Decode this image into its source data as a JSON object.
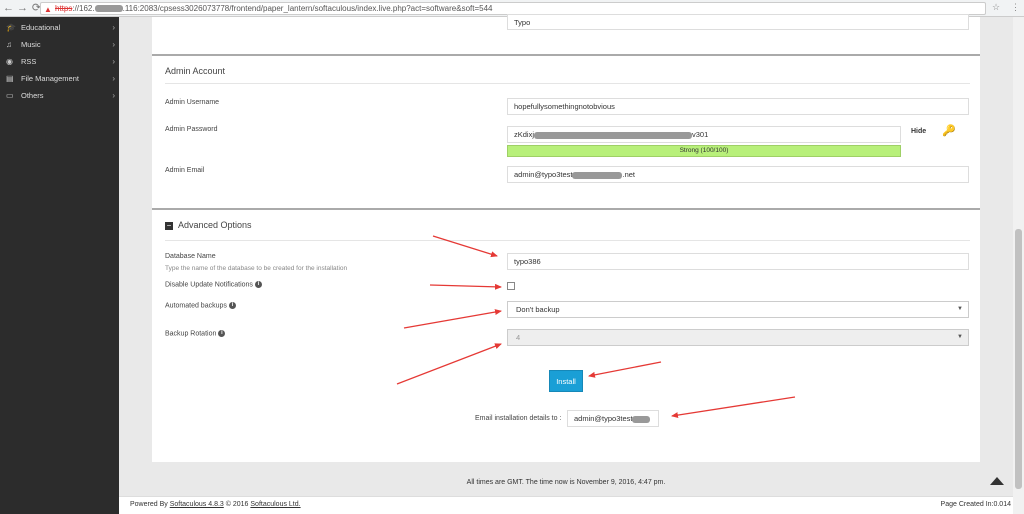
{
  "browser": {
    "url_scheme": "https",
    "url_host_start": "://162.",
    "url_host_end": ".116",
    "url_rest": ":2083/cpsess3026073778/frontend/paper_lantern/softaculous/index.live.php?act=software&soft=544"
  },
  "sidebar": {
    "items": [
      {
        "label": "Educational",
        "icon": "graduation-cap-icon"
      },
      {
        "label": "Music",
        "icon": "music-note-icon"
      },
      {
        "label": "RSS",
        "icon": "rss-icon"
      },
      {
        "label": "File Management",
        "icon": "file-management-icon"
      },
      {
        "label": "Others",
        "icon": "folder-icon"
      }
    ]
  },
  "top_field": {
    "value": "Typo"
  },
  "admin": {
    "title": "Admin Account",
    "username_label": "Admin Username",
    "username_value": "hopefullysomethingnotobvious",
    "password_label": "Admin Password",
    "password_start": "zKdixj",
    "password_end": "v301",
    "strength": "Strong (100/100)",
    "hide_label": "Hide",
    "email_label": "Admin Email",
    "email_start": "admin@typo3test",
    "email_end": ".net"
  },
  "advanced": {
    "title": "Advanced Options",
    "db_label": "Database Name",
    "db_sub": "Type the name of the database to be created for the installation",
    "db_value": "typo386",
    "disable_updates_label": "Disable Update Notifications",
    "backups_label": "Automated backups",
    "backups_value": "Don't backup",
    "rotation_label": "Backup Rotation",
    "rotation_value": "4"
  },
  "install_label": "Install",
  "email_details_label": "Email installation details to :",
  "email_details_value": "admin@typo3test",
  "footer_note": "All times are GMT. The time now is November 9, 2016, 4:47 pm.",
  "powered": {
    "prefix": "Powered By",
    "link": "Softaculous 4.8.3",
    "mid": "© 2016",
    "company": "Softaculous Ltd."
  },
  "page_created": "Page Created In:0.014",
  "colors": {
    "accent": "#1a9fd6",
    "strength": "#b8f07a",
    "sidebar": "#2c2c2c",
    "annotation_arrow": "#e53935"
  }
}
